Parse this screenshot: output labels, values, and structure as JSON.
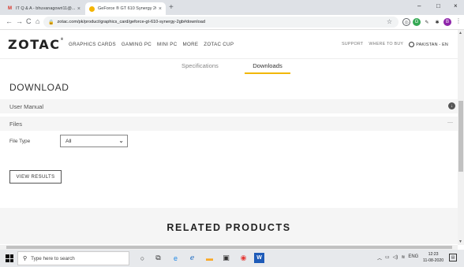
{
  "browser": {
    "tabs": [
      {
        "title": "IT Q & A - bhuvanagowri11@...",
        "favicon": "gmail-icon",
        "close": "×"
      },
      {
        "title": "GeForce ® GT 610 Synergy 2GB",
        "favicon": "zotac-icon",
        "close": "×"
      }
    ],
    "new_tab": "+",
    "window_controls": {
      "minimize": "–",
      "maximize": "□",
      "close": "×"
    },
    "nav": {
      "back": "←",
      "forward": "→",
      "reload": "C",
      "home": "⌂"
    },
    "url": "zotac.com/pk/product/graphics_card/geforce-gt-610-synergy-2gb#download",
    "profile_initial": "B"
  },
  "site": {
    "logo": "ZOTAC",
    "logo_mark": "®",
    "nav": [
      "GRAPHICS CARDS",
      "GAMING PC",
      "MINI PC",
      "MORE",
      "ZOTAC CUP"
    ],
    "right_nav": [
      "SUPPORT",
      "WHERE TO BUY"
    ],
    "region": "PAKISTAN - EN",
    "accent": "#f2b705"
  },
  "subtabs": [
    "Specifications",
    "Downloads"
  ],
  "download": {
    "title": "DOWNLOAD",
    "rows": [
      "User Manual",
      "Files"
    ],
    "file_type_label": "File Type",
    "file_type_value": "All",
    "button": "VIEW RESULTS"
  },
  "related": {
    "title": "RELATED PRODUCTS"
  },
  "taskbar": {
    "search_placeholder": "Type here to search",
    "language": "ENG",
    "time": "12:23",
    "date": "11-08-2020"
  }
}
